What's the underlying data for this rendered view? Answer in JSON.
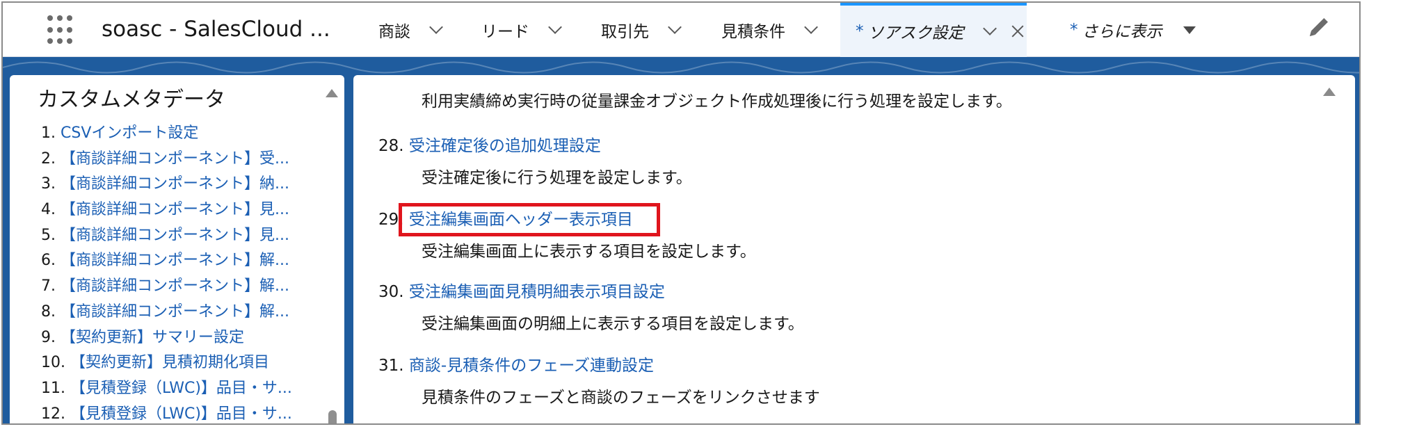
{
  "nav": {
    "app_name": "soasc - SalesCloud ...",
    "tabs": [
      {
        "label": "商談"
      },
      {
        "label": "リード"
      },
      {
        "label": "取引先"
      },
      {
        "label": "見積条件"
      }
    ],
    "active_tab": {
      "star": "*",
      "label": "ソアスク設定"
    },
    "more": {
      "star": "*",
      "label": "さらに表示"
    }
  },
  "sidebar": {
    "title": "カスタムメタデータ",
    "items": [
      {
        "num": "1.",
        "label": "CSVインポート設定"
      },
      {
        "num": "2.",
        "label": "【商談詳細コンポーネント】受..."
      },
      {
        "num": "3.",
        "label": "【商談詳細コンポーネント】納..."
      },
      {
        "num": "4.",
        "label": "【商談詳細コンポーネント】見..."
      },
      {
        "num": "5.",
        "label": "【商談詳細コンポーネント】見..."
      },
      {
        "num": "6.",
        "label": "【商談詳細コンポーネント】解..."
      },
      {
        "num": "7.",
        "label": "【商談詳細コンポーネント】解..."
      },
      {
        "num": "8.",
        "label": "【商談詳細コンポーネント】解..."
      },
      {
        "num": "9.",
        "label": "【契約更新】サマリー設定"
      },
      {
        "num": "10.",
        "label": "【契約更新】見積初期化項目"
      },
      {
        "num": "11.",
        "label": "【見積登録（LWC)】品目・サ..."
      },
      {
        "num": "12.",
        "label": "【見積登録（LWC)】品目・サ..."
      }
    ]
  },
  "main": {
    "top_desc": "利用実績締め実行時の従量課金オブジェクト作成処理後に行う処理を設定します。",
    "items": [
      {
        "num": "28.",
        "title": "受注確定後の追加処理設定",
        "desc": "受注確定後に行う処理を設定します。"
      },
      {
        "num": "29.",
        "title": "受注編集画面ヘッダー表示項目",
        "desc": "受注編集画面上に表示する項目を設定します。"
      },
      {
        "num": "30.",
        "title": "受注編集画面見積明細表示項目設定",
        "desc": "受注編集画面の明細上に表示する項目を設定します。"
      },
      {
        "num": "31.",
        "title": "商談-見積条件のフェーズ連動設定",
        "desc": "見積条件のフェーズと商談のフェーズをリンクさせます"
      }
    ]
  },
  "colors": {
    "link": "#1b5fb4",
    "highlight": "#e0151d",
    "backdrop": "#1f5c9e",
    "active_tab_border": "#1b96ff"
  }
}
